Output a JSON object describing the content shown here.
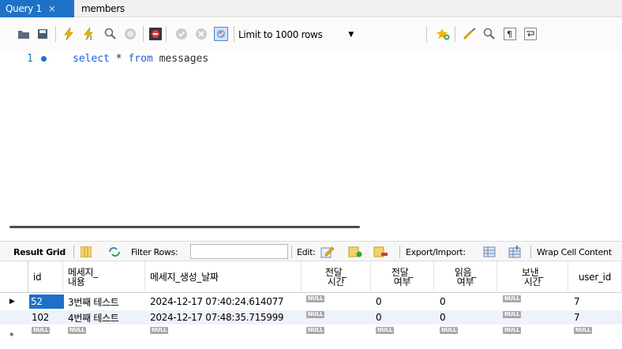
{
  "tabs": [
    {
      "label": "Query 1",
      "close": "×"
    },
    {
      "label": "members"
    }
  ],
  "toolbar": {
    "limit_label": "Limit to 1000 rows",
    "icons": [
      "open-folder-icon",
      "save-icon",
      "execute-icon",
      "execute-current-icon",
      "explain-icon",
      "stop-icon",
      "toggle-error-icon",
      "commit-icon",
      "rollback-icon",
      "autocommit-icon",
      "add-bookmark-icon",
      "beautify-icon",
      "find-icon",
      "invisible-chars-icon",
      "wrap-icon"
    ]
  },
  "editor": {
    "line_number": "1",
    "tokens": [
      {
        "text": "select",
        "type": "kw"
      },
      {
        "text": " * ",
        "type": "id"
      },
      {
        "text": "from",
        "type": "kw"
      },
      {
        "text": " messages",
        "type": "id"
      }
    ]
  },
  "result_toolbar": {
    "result_grid": "Result Grid",
    "filter_rows": "Filter Rows:",
    "edit": "Edit:",
    "export_import": "Export/Import:",
    "wrap": "Wrap Cell Content"
  },
  "grid": {
    "null_label": "NULL",
    "columns": [
      {
        "l1": "id",
        "l2": ""
      },
      {
        "l1": "메세지_",
        "l2": "내용"
      },
      {
        "l1": "메세지_생성_날짜",
        "l2": ""
      },
      {
        "l1": "전달_",
        "l2": "시간"
      },
      {
        "l1": "전달_",
        "l2": "여부"
      },
      {
        "l1": "읽음_",
        "l2": "여부"
      },
      {
        "l1": "보낸_",
        "l2": "시간"
      },
      {
        "l1": "user_id",
        "l2": ""
      }
    ],
    "rows": [
      {
        "id": "52",
        "content": "3번째 테스트",
        "created": "2024-12-17 07:40:24.614077",
        "sent_time": null,
        "delivered": "0",
        "read": "0",
        "send_time": null,
        "user_id": "7"
      },
      {
        "id": "102",
        "content": "4번째 테스트",
        "created": "2024-12-17 07:48:35.715999",
        "sent_time": null,
        "delivered": "0",
        "read": "0",
        "send_time": null,
        "user_id": "7"
      }
    ],
    "current_marker": "▶",
    "new_marker": "*"
  }
}
